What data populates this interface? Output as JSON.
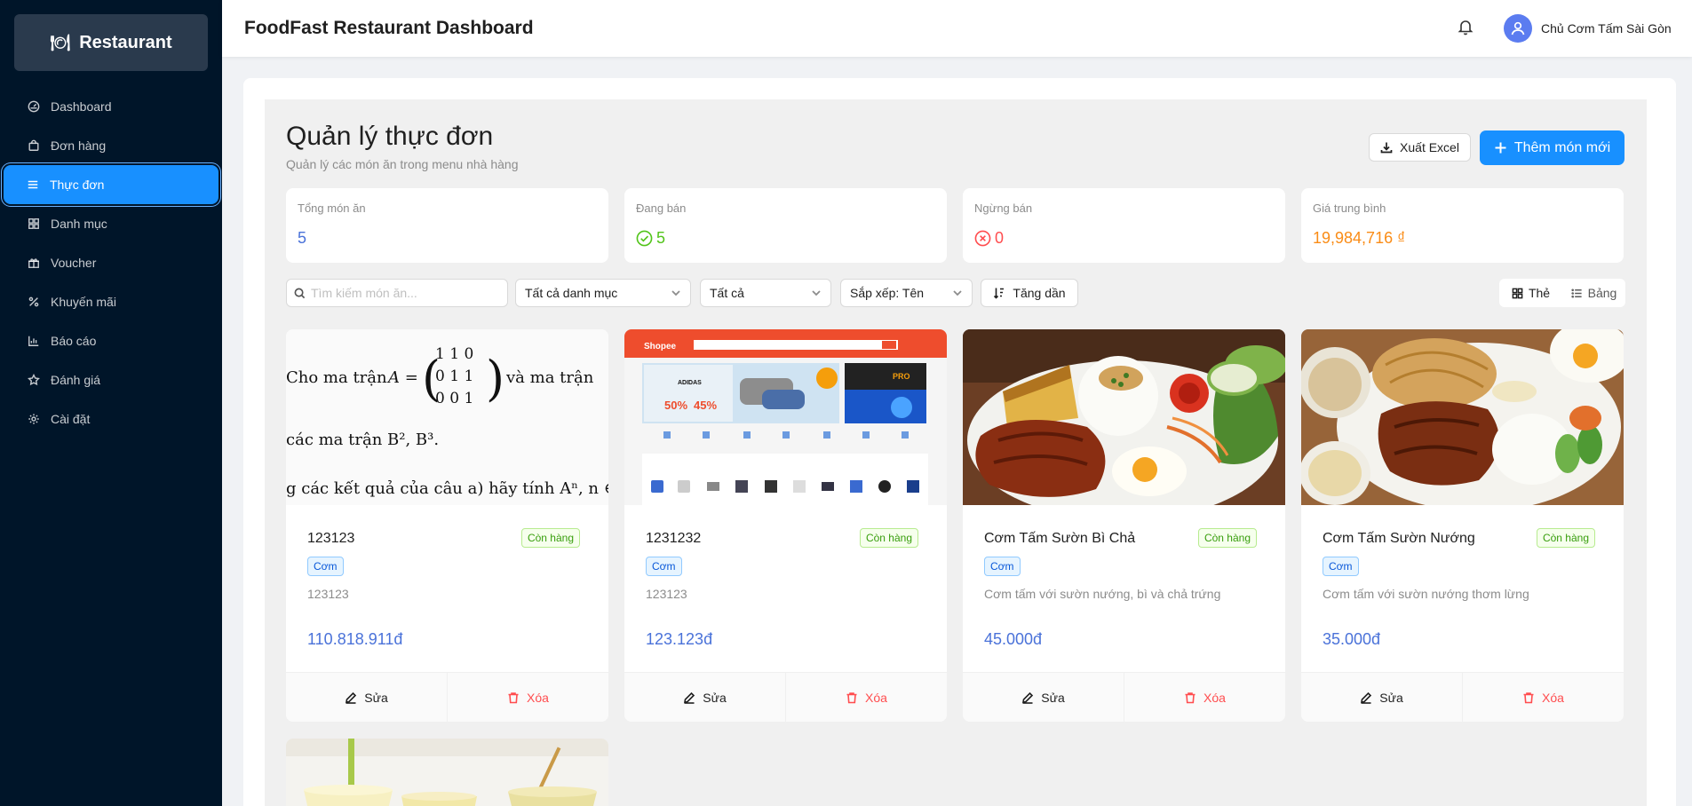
{
  "sidebar": {
    "logo": "Restaurant",
    "items": [
      {
        "label": "Dashboard"
      },
      {
        "label": "Đơn hàng"
      },
      {
        "label": "Thực đơn"
      },
      {
        "label": "Danh mục"
      },
      {
        "label": "Voucher"
      },
      {
        "label": "Khuyến mãi"
      },
      {
        "label": "Báo cáo"
      },
      {
        "label": "Đánh giá"
      },
      {
        "label": "Cài đặt"
      }
    ]
  },
  "header": {
    "title": "FoodFast Restaurant Dashboard",
    "username": "Chủ Cơm Tấm Sài Gòn"
  },
  "page": {
    "title": "Quản lý thực đơn",
    "subtitle": "Quản lý các món ăn trong menu nhà hàng",
    "export_label": "Xuất Excel",
    "add_label": "Thêm món mới"
  },
  "stats": [
    {
      "label": "Tổng món ăn",
      "value": "5",
      "color": "#4a72d9"
    },
    {
      "label": "Đang bán",
      "value": "5",
      "color": "#52c41a"
    },
    {
      "label": "Ngừng bán",
      "value": "0",
      "color": "#ff4d4f"
    },
    {
      "label": "Giá trung bình",
      "value": "19,984,716 ₫",
      "color": "#fa8c16"
    }
  ],
  "filters": {
    "search_placeholder": "Tìm kiếm món ăn...",
    "category": "Tất cả danh mục",
    "status": "Tất cả",
    "sort": "Sắp xếp: Tên",
    "order": "Tăng dần",
    "view_card": "Thẻ",
    "view_table": "Bảng"
  },
  "dishes": [
    {
      "name": "123123",
      "status": "Còn hàng",
      "category": "Cơm",
      "description": "123123",
      "price": "110.818.911đ",
      "edit": "Sửa",
      "delete": "Xóa"
    },
    {
      "name": "1231232",
      "status": "Còn hàng",
      "category": "Cơm",
      "description": "123123",
      "price": "123.123đ",
      "edit": "Sửa",
      "delete": "Xóa"
    },
    {
      "name": "Cơm Tấm Sườn Bì Chả",
      "status": "Còn hàng",
      "category": "Cơm",
      "description": "Cơm tấm với sườn nướng, bì và chả trứng",
      "price": "45.000đ",
      "edit": "Sửa",
      "delete": "Xóa"
    },
    {
      "name": "Cơm Tấm Sườn Nướng",
      "status": "Còn hàng",
      "category": "Cơm",
      "description": "Cơm tấm với sườn nướng thơm lừng",
      "price": "35.000đ",
      "edit": "Sửa",
      "delete": "Xóa"
    }
  ],
  "image_texts": {
    "math_line1": "Cho ma trận",
    "math_line1b": "và ma trận",
    "math_line2": "các ma trận B², B³.",
    "math_line3": "g các kết quả của câu a) hãy tính Aⁿ, n ∈",
    "shopee_logo": "Shopee",
    "shopee_promo": "ADIDAS",
    "shopee_discount1": "50%",
    "shopee_discount2": "45%",
    "shopee_pro": "PRO"
  }
}
